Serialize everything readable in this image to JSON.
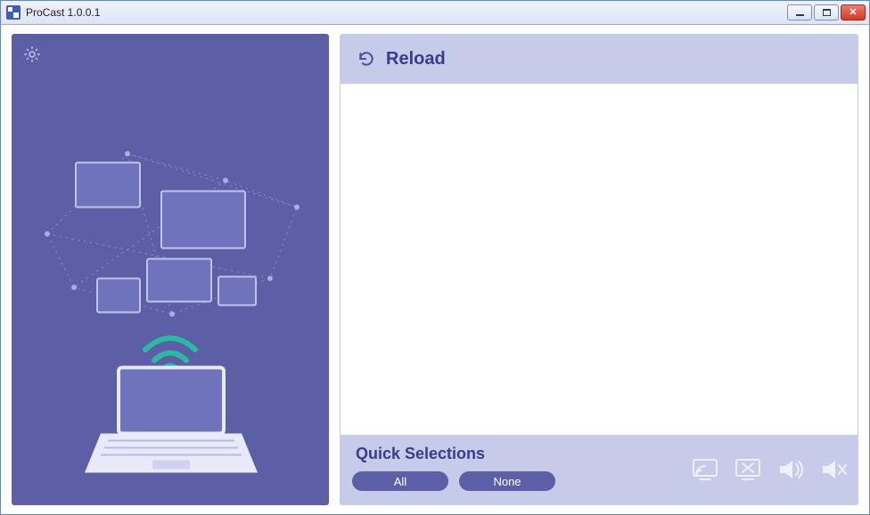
{
  "window": {
    "title": "ProCast 1.0.0.1"
  },
  "top": {
    "reload_label": "Reload"
  },
  "bottom": {
    "quick_selections_label": "Quick Selections",
    "all_label": "All",
    "none_label": "None",
    "icons": {
      "cast": "cast-icon",
      "stop_cast": "stop-cast-icon",
      "volume": "volume-icon",
      "mute": "mute-icon"
    }
  }
}
